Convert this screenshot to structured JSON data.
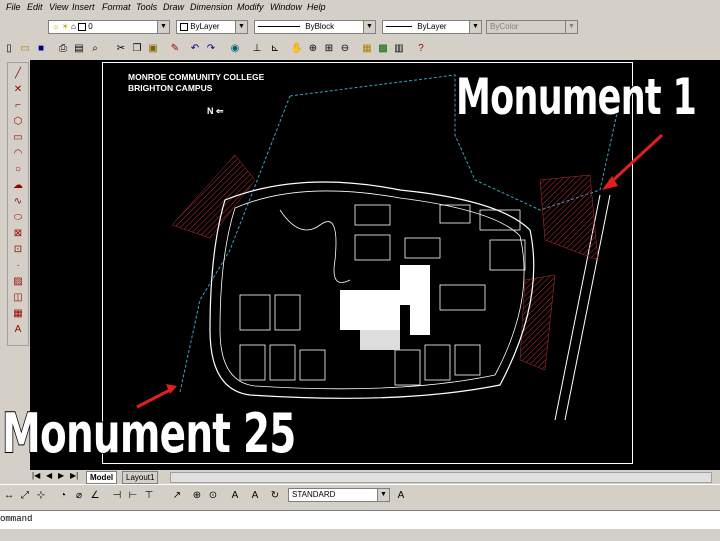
{
  "menu": [
    "File",
    "Edit",
    "View",
    "Insert",
    "Format",
    "Tools",
    "Draw",
    "Dimension",
    "Modify",
    "Window",
    "Help"
  ],
  "layer_toolbar": {
    "layer_value": "0",
    "color_value": "ByLayer",
    "linetype_value": "ByBlock",
    "lineweight_value": "ByLayer",
    "plotstyle_value": "ByColor"
  },
  "drawing": {
    "title_line1": "MONROE COMMUNITY COLLEGE",
    "title_line2": "BRIGHTON CAMPUS",
    "north_label": "N",
    "annotation_1": "Monument 1",
    "annotation_25": "Monument 25"
  },
  "tabs": {
    "model": "Model",
    "layout": "Layout1"
  },
  "bottom_toolbar": {
    "text_style_value": "STANDARD"
  },
  "command_line": {
    "text": "ommand"
  },
  "colors": {
    "ui_face": "#d4d0c8",
    "canvas": "#000000",
    "arrow": "#e02020",
    "hatch": "#c03030"
  }
}
